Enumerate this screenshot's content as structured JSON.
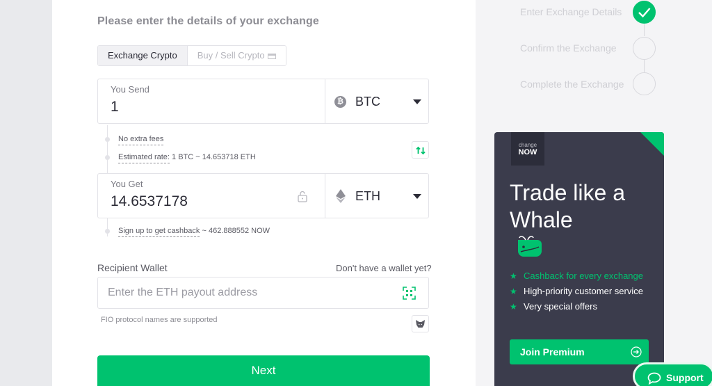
{
  "heading": "Please enter the details of your exchange",
  "tabs": [
    {
      "label": "Exchange Crypto",
      "active": true
    },
    {
      "label": "Buy / Sell Crypto",
      "active": false
    }
  ],
  "send": {
    "label": "You Send",
    "amount": "1",
    "currency": "BTC",
    "currency_icon": "bitcoin-icon"
  },
  "fees": {
    "no_fees": "No extra fees",
    "rate_label": "Estimated rate:",
    "rate_value": " 1 BTC ~ 14.653718 ETH"
  },
  "get": {
    "label": "You Get",
    "amount": "14.6537178",
    "currency": "ETH",
    "currency_icon": "ethereum-icon"
  },
  "cashback": {
    "link": "Sign up to get cashback",
    "value": " ~ 462.888552 NOW"
  },
  "recipient": {
    "label": "Recipient Wallet",
    "no_wallet_link": "Don't have a wallet yet?",
    "placeholder": "Enter the ETH payout address",
    "fio_note": "FIO protocol names are supported"
  },
  "next_button": "Next",
  "steps": [
    {
      "label": "Enter Exchange Details",
      "done": true
    },
    {
      "label": "Confirm the Exchange",
      "done": false
    },
    {
      "label": "Complete the Exchange",
      "done": false
    }
  ],
  "promo": {
    "logo_line1": "change",
    "logo_line2": "NOW",
    "title": "Trade like a Whale",
    "benefits": [
      "Cashback for every exchange",
      "High-priority customer service",
      "Very special offers"
    ],
    "cta": "Join Premium"
  },
  "support": {
    "label": "Support"
  },
  "colors": {
    "accent": "#00c26f",
    "promo_bg": "#3b3c4c",
    "text": "#2b2b36",
    "muted": "#8d8d94"
  }
}
